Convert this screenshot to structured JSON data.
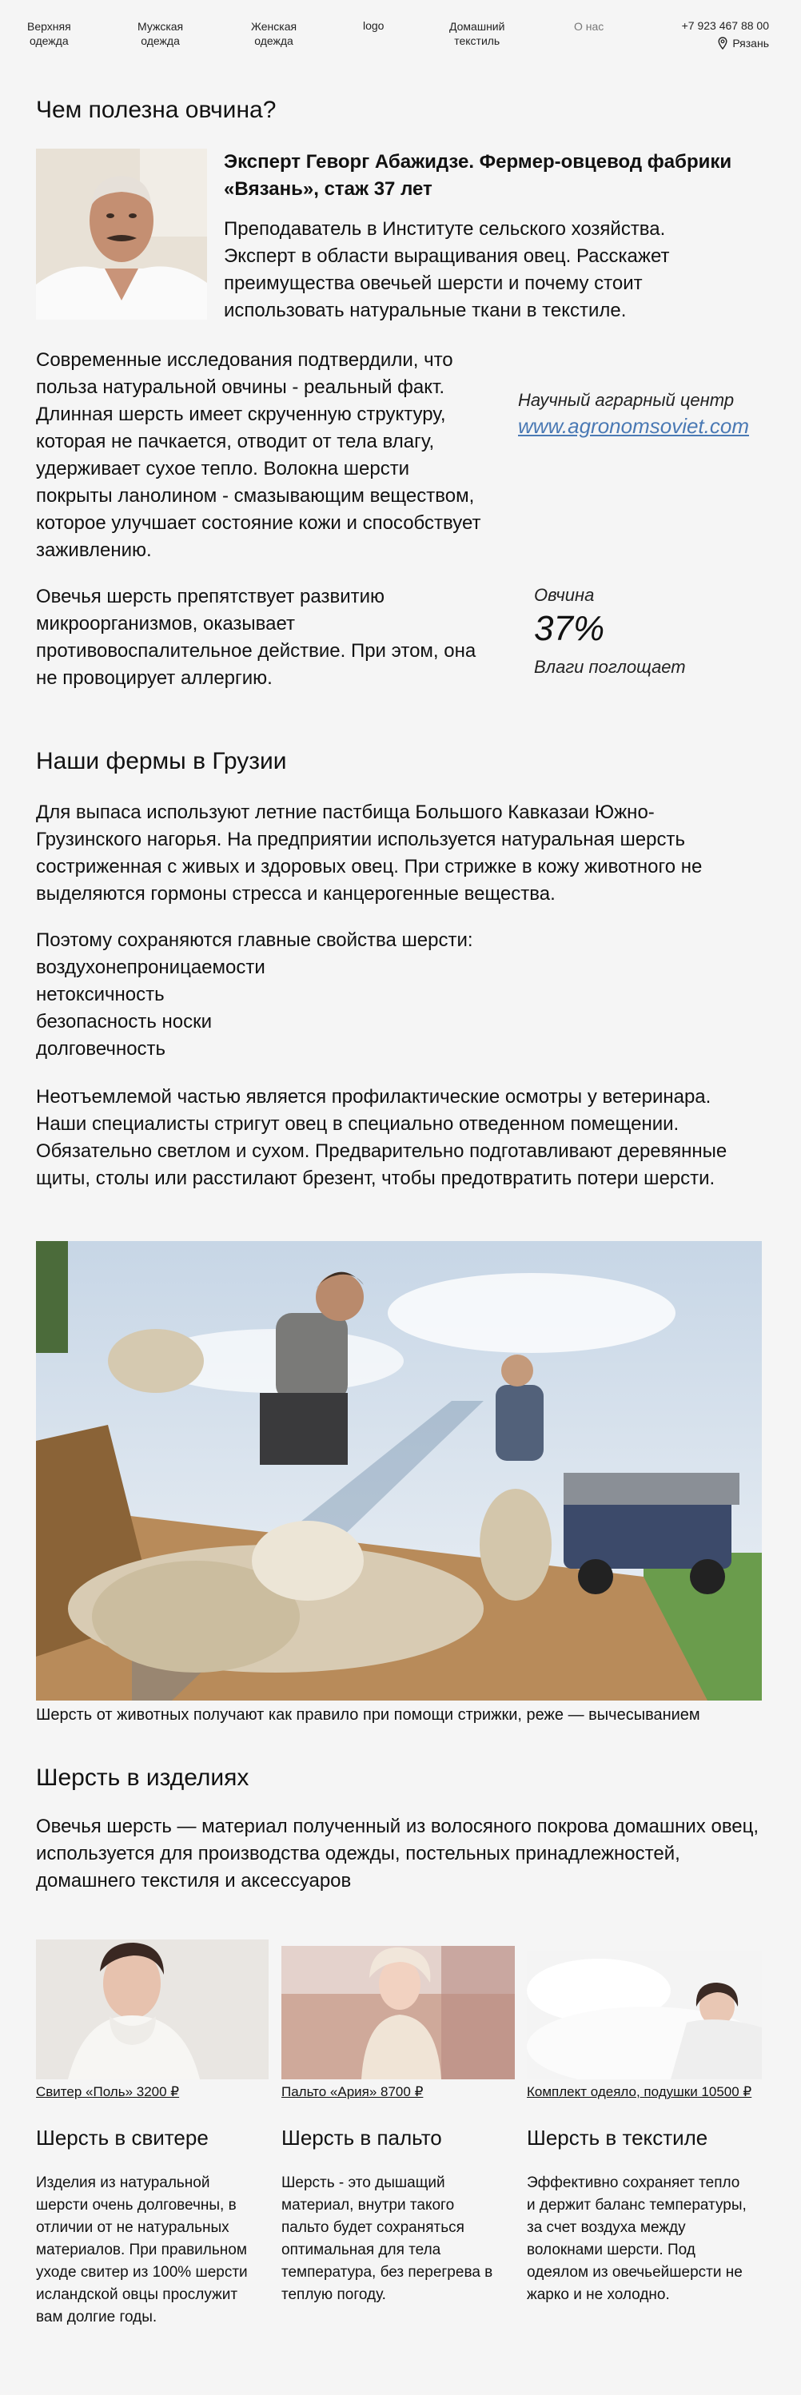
{
  "nav": {
    "items": [
      {
        "label_1": "Верхняя",
        "label_2": "одежда"
      },
      {
        "label_1": "Мужская",
        "label_2": "одежда"
      },
      {
        "label_1": "Женская",
        "label_2": "одежда"
      },
      {
        "label_1": "Домашний",
        "label_2": "текстиль"
      },
      {
        "label_1": "О нас",
        "label_2": ""
      }
    ],
    "logo": "logo",
    "phone": "+7 923 467 88 00",
    "city": "Рязань"
  },
  "intro": {
    "title": "Чем полезна овчина?",
    "expert_name": "Эксперт Геворг Абажидзе. Фермер-овцевод фабрики «Вязань», стаж 37 лет",
    "expert_desc": "Преподаватель в Институте сельского хозяйства. Эксперт в области выращивания овец. Расскажет преимущества овечьей шерсти и почему стоит использовать натуральные ткани в текстиле.",
    "para_1": "Современные исследования подтвердили, что польза натуральной овчины - реальный факт. Длинная шерсть имеет скрученную структуру, которая не пачкается, отводит от тела влагу, удерживает сухое тепло. Волокна шерсти покрыты ланолином - смазывающим веществом, которое улучшает состояние кожи и способствует заживлению.",
    "para_2": "Овечья шерсть препятствует развитию микроорганизмов, оказывает противовоспалительное действие. При этом, она не провоцирует аллергию.",
    "center_label": "Научный аграрный центр",
    "center_link": "www.agronomsoviet.com",
    "stat_label": "Овчина",
    "stat_value": "37%",
    "stat_desc": "Влаги поглощает"
  },
  "farms": {
    "title": "Наши фермы в Грузии",
    "para_1": "Для выпаса используют летние пастбища Большого Кавказаи Южно-Грузинского нагорья. На предприятии используется натуральная шерсть состриженная с живых и здоровых овец. При стрижке в кожу животного не выделяются гормоны стресса и канцерогенные вещества.",
    "props_intro": "Поэтому сохраняются главные свойства шерсти:",
    "props": [
      "воздухонепроницаемости",
      "нетоксичность",
      "безопасность носки",
      "долговечность"
    ],
    "para_2": "Неотъемлемой частью является профилактические осмотры у ветеринара. Наши специалисты стригут овец в специально отведенном помещении. Обязательно светлом и сухом. Предварительно подготавливают деревянные щиты, столы или расстилают брезент, чтобы предотвратить потери шерсти.",
    "caption": "Шерсть от животных получают как правило при помощи стрижки, реже — вычесыванием"
  },
  "products": {
    "title": "Шерсть в изделиях",
    "intro": "Овечья шерсть — материал полученный из волосяного покрова домашних овец, используется для производства одежды, постельных принадлежностей, домашнего текстиля и аксессуаров",
    "cards": [
      {
        "price": "Свитер «Поль» 3200 ₽",
        "title": "Шерсть в свитере",
        "text": "Изделия из натуральной шерсти очень долговечны, в отличии от не натуральных материалов. При правильном уходе свитер из 100% шерсти исландской овцы прослужит вам долгие годы."
      },
      {
        "price": "Пальто «Ария» 8700 ₽",
        "title": "Шерсть в пальто",
        "text": "Шерсть - это дышащий материал, внутри такого пальто будет сохраняться оптимальная для тела температура, без перегрева в теплую погоду."
      },
      {
        "price": "Комплект одеяло, подушки 10500 ₽",
        "title": "Шерсть в текстиле",
        "text": "Эффективно сохраняет тепло и держит баланс температуры, за счет воздуха между волокнами шерсти. Под одеялом из овечьейшерсти не жарко и не холодно."
      }
    ]
  },
  "colors": {
    "background": "#f5f5f5",
    "link": "#4a79b4",
    "muted": "#777777"
  }
}
